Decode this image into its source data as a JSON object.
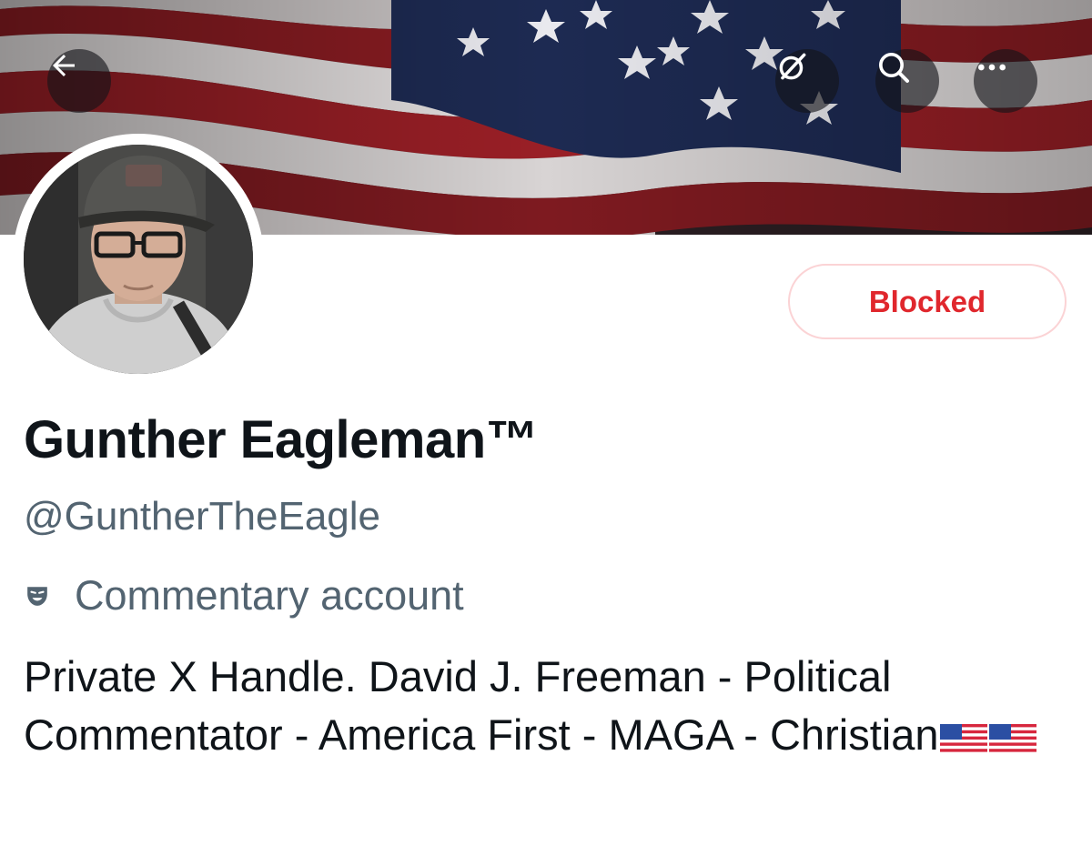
{
  "header": {
    "back_icon": "arrow-left-icon",
    "grok_icon": "grok-icon",
    "search_icon": "search-icon",
    "more_icon": "more-horizontal-icon"
  },
  "profile": {
    "display_name": "Gunther Eagleman™",
    "handle": "@GuntherTheEagle",
    "label": "Commentary account",
    "label_icon": "theater-mask-icon",
    "bio": "Private X Handle. David J. Freeman - Political Commentator - America First - MAGA - Christian",
    "bio_emoji": [
      "us-flag",
      "us-flag"
    ],
    "follow_state_label": "Blocked"
  },
  "colors": {
    "blocked_red": "#e0272d",
    "blocked_border": "#fbd3d5",
    "secondary_text": "#536471",
    "primary_text": "#0f1419"
  }
}
